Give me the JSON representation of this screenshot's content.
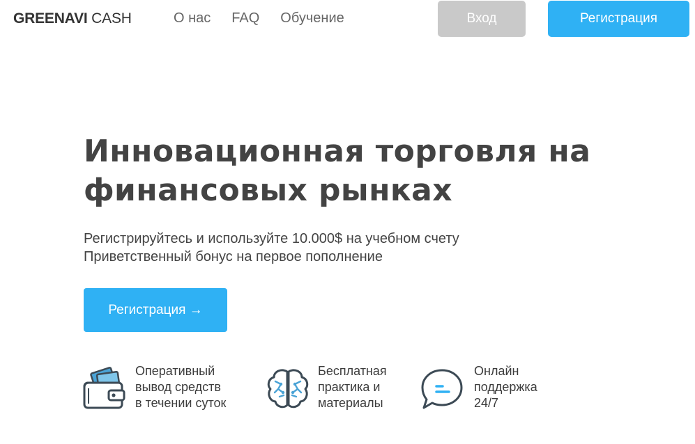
{
  "header": {
    "logo_bold": "GREENAVI",
    "logo_light": " CASH",
    "nav": [
      {
        "label": "О нас"
      },
      {
        "label": "FAQ"
      },
      {
        "label": "Обучение"
      }
    ],
    "login_label": "Вход",
    "register_label": "Регистрация"
  },
  "hero": {
    "title_line1": "Инновационная торговля на",
    "title_line2": "финансовых рынках",
    "subtitle_line1": "Регистрируйтесь и используйте 10.000$ на учебном счету",
    "subtitle_line2": "Приветственный бонус на первое пополнение",
    "cta_label": "Регистрация →"
  },
  "features": [
    {
      "icon": "wallet-icon",
      "lines": [
        "Оперативный",
        "вывод средств",
        "в течении суток"
      ]
    },
    {
      "icon": "brain-icon",
      "lines": [
        "Бесплатная",
        "практика и",
        "материалы"
      ]
    },
    {
      "icon": "chat-bubble-icon",
      "lines": [
        "Онлайн",
        "поддержка",
        "24/7"
      ]
    }
  ],
  "colors": {
    "accent": "#2fb1f4",
    "login_button": "#c9c9c9",
    "heading": "#434343",
    "nav_text": "#666666"
  }
}
